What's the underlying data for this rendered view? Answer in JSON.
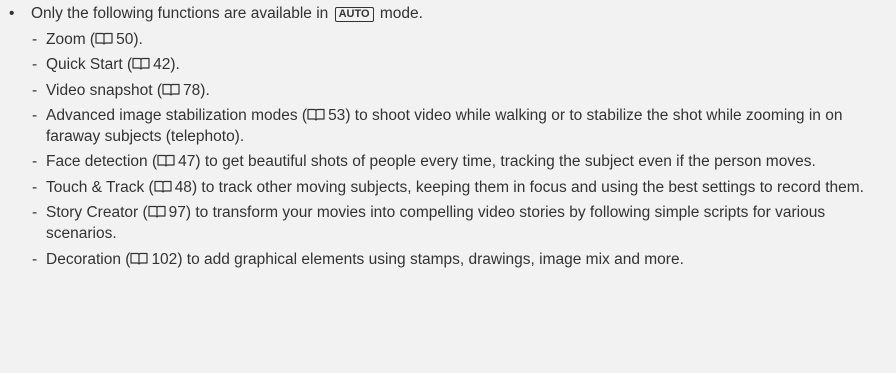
{
  "intro": {
    "bullet": "•",
    "before": "Only the following functions are available in",
    "mode_key": "AUTO",
    "after": "mode."
  },
  "page_ref_icon": "book-page-reference-icon",
  "items": [
    {
      "dash": "-",
      "name": "Zoom",
      "open": " (",
      "page": "50",
      "rest": ")."
    },
    {
      "dash": "-",
      "name": "Quick Start",
      "open": " (",
      "page": "42",
      "rest": ")."
    },
    {
      "dash": "-",
      "name": "Video snapshot",
      "open": " (",
      "page": "78",
      "rest": ")."
    },
    {
      "dash": "-",
      "name": "Advanced image stabilization modes",
      "open": " (",
      "page": "53",
      "rest": ") to shoot video while walking or to stabilize the shot while zooming in on faraway subjects (telephoto)."
    },
    {
      "dash": "-",
      "name": "Face detection",
      "open": " (",
      "page": "47",
      "rest": ") to get beautiful shots of people every time, tracking the subject even if the person moves."
    },
    {
      "dash": "-",
      "name": "Touch & Track",
      "open": " (",
      "page": "48",
      "rest": ") to track other moving subjects, keeping them in focus and using the best settings to record them."
    },
    {
      "dash": "-",
      "name": "Story Creator",
      "open": " (",
      "page": "97",
      "rest": ") to transform your movies into compelling video stories by following simple scripts for various scenarios."
    },
    {
      "dash": "-",
      "name": "Decoration",
      "open": " (",
      "page": "102",
      "rest": ") to add graphical elements using stamps, drawings, image mix and more."
    }
  ]
}
